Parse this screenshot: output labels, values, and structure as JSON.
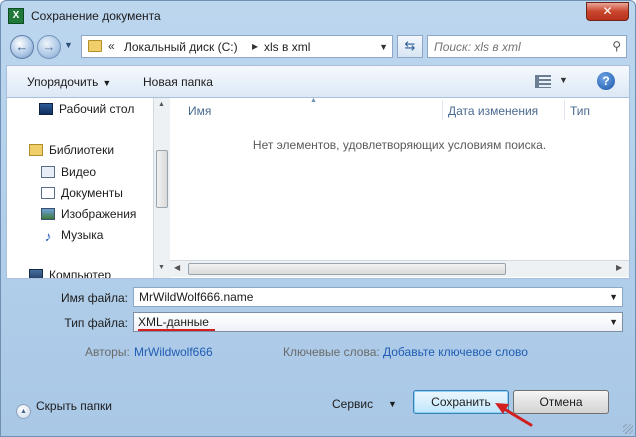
{
  "window": {
    "title": "Сохранение документа",
    "close_label": "✕"
  },
  "nav": {
    "back_icon": "back-arrow-icon",
    "forward_icon": "forward-arrow-icon",
    "breadcrumb_prefix": "«",
    "breadcrumb": [
      "Локальный диск (C:)",
      "xls в xml"
    ],
    "breadcrumb_separator": "▸",
    "search_placeholder": "Поиск: xls в xml"
  },
  "toolbar": {
    "organize": "Упорядочить",
    "new_folder": "Новая папка"
  },
  "sidebar": {
    "items": [
      {
        "label": "Рабочий стол",
        "icon": "desktop-icon"
      },
      {
        "label": "Библиотеки",
        "icon": "libraries-icon"
      },
      {
        "label": "Видео",
        "icon": "video-icon"
      },
      {
        "label": "Документы",
        "icon": "documents-icon"
      },
      {
        "label": "Изображения",
        "icon": "pictures-icon"
      },
      {
        "label": "Музыка",
        "icon": "music-icon"
      },
      {
        "label": "Компьютер",
        "icon": "computer-icon"
      }
    ]
  },
  "file_list": {
    "columns": [
      "Имя",
      "Дата изменения",
      "Тип"
    ],
    "empty_message": "Нет элементов, удовлетворяющих условиям поиска."
  },
  "form": {
    "filename_label": "Имя файла:",
    "filename_value": "MrWildWolf666.name",
    "filetype_label": "Тип файла:",
    "filetype_value": "XML-данные",
    "authors_label": "Авторы:",
    "authors_value": "MrWildwolf666",
    "keywords_label": "Ключевые слова:",
    "keywords_value": "Добавьте ключевое слово"
  },
  "footer": {
    "hide_folders": "Скрыть папки",
    "service": "Сервис",
    "save": "Сохранить",
    "cancel": "Отмена"
  },
  "colors": {
    "annotation_arrow": "#d21f1f",
    "link": "#1f5cb3",
    "header_text": "#4a6a91"
  }
}
